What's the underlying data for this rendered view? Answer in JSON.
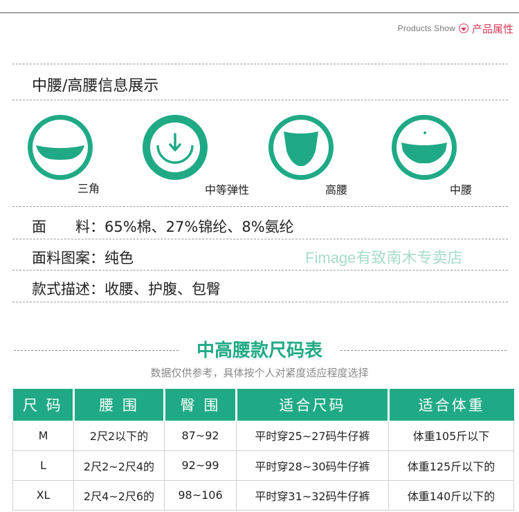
{
  "header": {
    "product_show_en": "Products Show",
    "product_show_cn": "产品属性"
  },
  "section": {
    "title": "中腰/高腰信息展示"
  },
  "icons": [
    {
      "name": "triangle-brief-icon",
      "label": "三角"
    },
    {
      "name": "medium-elastic-icon",
      "label": "中等弹性"
    },
    {
      "name": "high-waist-icon",
      "label": "高腰"
    },
    {
      "name": "mid-waist-icon",
      "label": "中腰"
    }
  ],
  "info": {
    "fabric_label": "面　　料：",
    "fabric_value": "65%棉、27%锦纶、8%氨纶",
    "pattern_label": "面料图案：",
    "pattern_value": "纯色",
    "style_label": "款式描述：",
    "style_value": "收腰、护腹、包臀",
    "watermark": "Fimage有致南木专卖店"
  },
  "size_chart": {
    "title": "中高腰款尺码表",
    "subtitle": "数据仅供参考，具体按个人对紧度适应程度选择",
    "headers": [
      "尺 码",
      "腰 围",
      "臀 围",
      "适合尺码",
      "适合体重"
    ],
    "rows": [
      [
        "M",
        "2尺2以下的",
        "87~92",
        "平时穿25~27码牛仔裤",
        "体重105斤以下"
      ],
      [
        "L",
        "2尺2~2尺4的",
        "92~99",
        "平时穿28~30码牛仔裤",
        "体重125斤以下的"
      ],
      [
        "XL",
        "2尺4~2尺6的",
        "98~106",
        "平时穿31~32码牛仔裤",
        "体重140斤以下的"
      ]
    ]
  },
  "colors": {
    "accent": "#1faa85",
    "brand_red": "#d43c5b",
    "watermark": "#a6dccb"
  }
}
